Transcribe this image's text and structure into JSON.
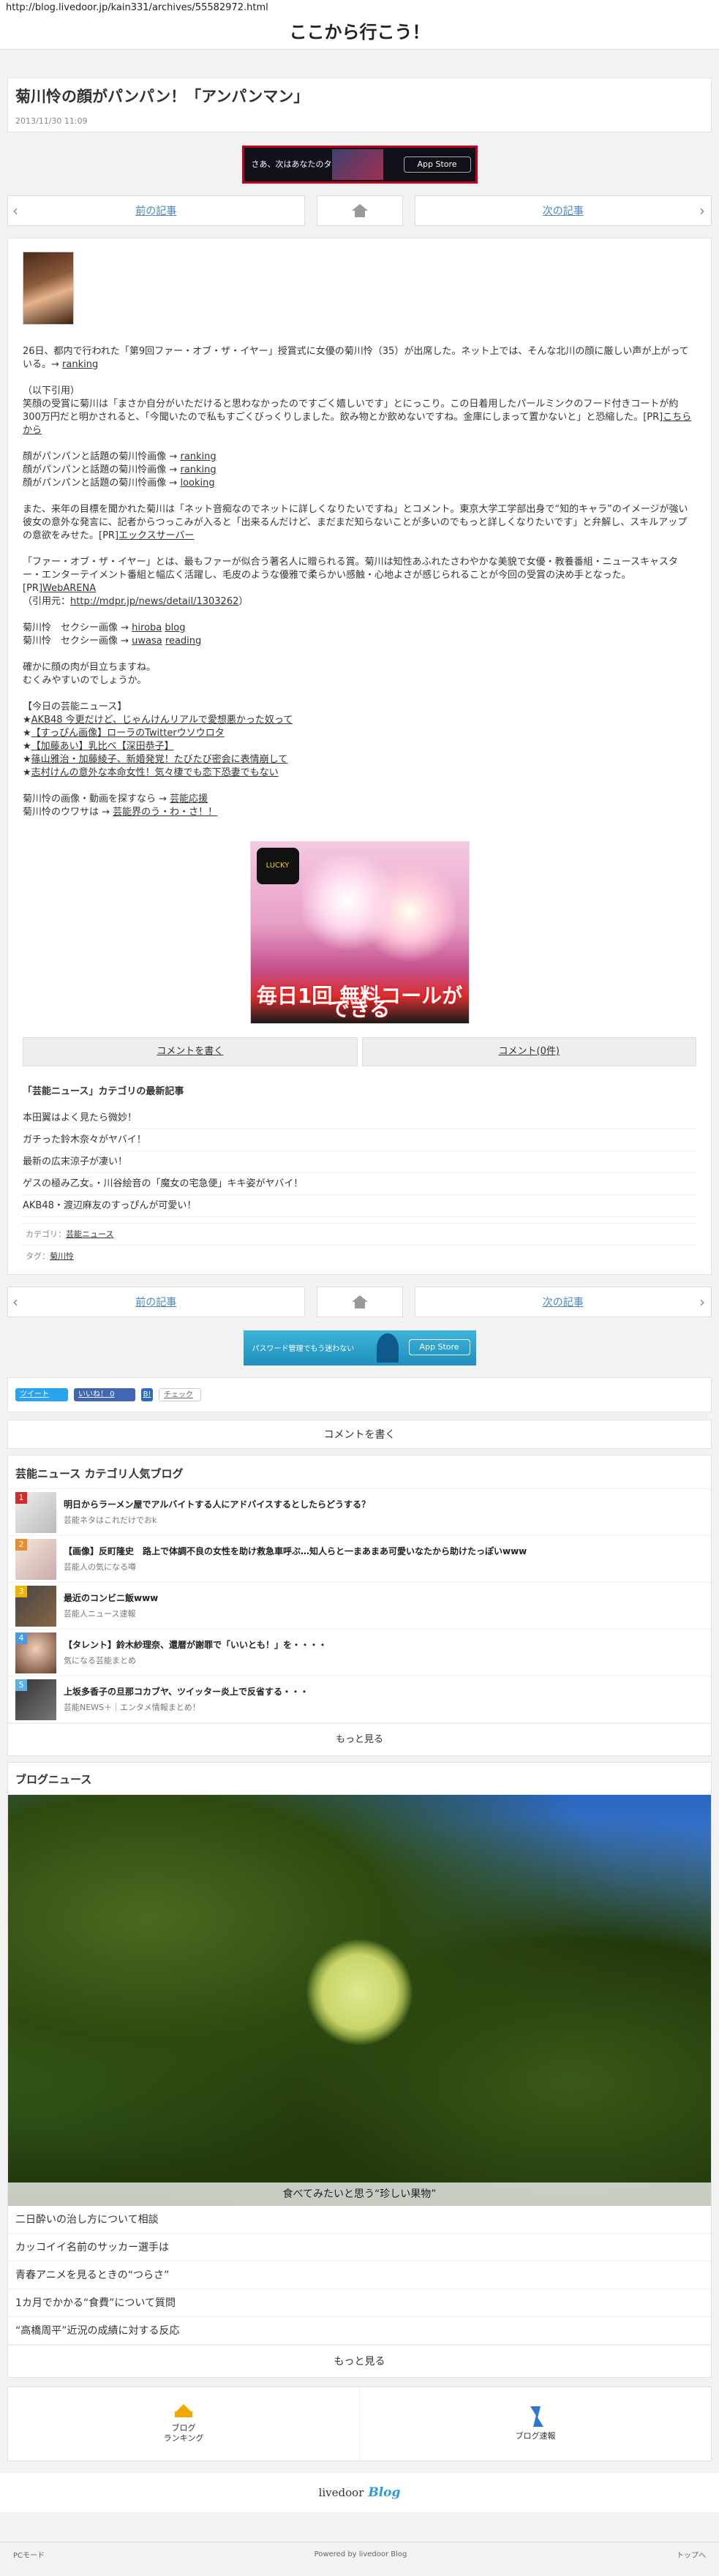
{
  "browser": {
    "url": "http://blog.livedoor.jp/kain331/archives/55582972.html"
  },
  "site": {
    "title": "ここから行こう！"
  },
  "article": {
    "title": "菊川怜の顔がパンパン！「アンパンマン」",
    "date": "2013/11/30 11:09"
  },
  "ads": {
    "banner1_text": "さあ、次はあなたのターン",
    "appstore": "App Store",
    "banner2_text": "パスワード管理でもう迷わない",
    "game_text": "毎日1回 無料コールができる",
    "game_logo": "LUCKY"
  },
  "pager": {
    "prev": "前の記事",
    "next": "次の記事",
    "prev_arrow": "‹",
    "next_arrow": "›"
  },
  "body": {
    "p1": "26日、都内で行われた「第9回ファー・オブ・ザ・イヤー」授賞式に女優の菊川怜（35）が出席した。ネット上では、そんな北川の顔に厳しい声が上がっている。→",
    "p1_link": "ranking",
    "p2": "（以下引用）\n笑顔の受賞に菊川は「まさか自分がいただけると思わなかったのですごく嬉しいです」とにっこり。この日着用したパールミンクのフード付きコートが約300万円だと明かされると、「今聞いたので私もすごくびっくりしました。飲み物とか飲めないですね。金庫にしまって置かないと」と恐縮した。[PR]",
    "p2_link": "こちらから",
    "l1": "顔がパンパンと話題の菊川怜画像 →",
    "l1_link": "ranking",
    "l2": "顔がパンパンと話題の菊川怜画像 →",
    "l2_link": "ranking",
    "l3": "顔がパンパンと話題の菊川怜画像 →",
    "l3_link": "looking",
    "p3": "また、来年の目標を聞かれた菊川は「ネット音痴なのでネットに詳しくなりたいですね」とコメント。東京大学工学部出身で“知的キャラ”のイメージが強い彼女の意外な発言に、記者からつっこみが入ると「出来るんだけど、まだまだ知らないことが多いのでもっと詳しくなりたいです」と弁解し、スキルアップの意欲をみせた。[PR]",
    "p3_link": "エックスサーバー",
    "p4": "「ファー・オブ・ザ・イヤー」とは、最もファーが似合う著名人に贈られる賞。菊川は知性あふれたさわやかな美貌で女優・教養番組・ニュースキャスター・エンターテイメント番組と幅広く活躍し、毛皮のような優雅で柔らかい感触・心地よさが感じられることが今回の受賞の決め手となった。",
    "p4_pr": "[PR]",
    "p4_link": "WebARENA",
    "p4_src": "（引用元：",
    "p4_src_link": "http://mdpr.jp/news/detail/1303262",
    "p4_src_end": "）",
    "s1": "菊川怜　セクシー画像 →",
    "s1_link1": "hiroba",
    "s1_link2": "blog",
    "s2": "菊川怜　セクシー画像 →",
    "s2_link1": "uwasa",
    "s2_link2": "reading",
    "p5a": "確かに顔の肉が目立ちますね。",
    "p5b": "むくみやすいのでしょうか。",
    "news_h": "【今日の芸能ニュース】",
    "n1": "AKB48 今更だけど、じゃんけんリアルで愛想悪かった奴って",
    "n2": "【すっぴん画像】ローラのTwitterウソウロタ",
    "n3": "【加藤あい】乳比べ【深田恭子】",
    "n4": "篠山雅治・加藤綾子、新婚発覚！たびたび密会に表情崩して",
    "n5": "志村けんの意外な本命女性！気々棲でも恋下恐妻でもない",
    "f1": "菊川怜の画像・動画を探すなら →",
    "f1_link": "芸能応援",
    "f2": "菊川怜のウワサは →",
    "f2_link": "芸能界のう・わ・さ！！"
  },
  "comments": {
    "write": "コメントを書く",
    "count": "コメント(0件)"
  },
  "category": {
    "heading": "「芸能ニュース」カテゴリの最新記事",
    "items": [
      "本田翼はよく見たら微妙！",
      "ガチった鈴木奈々がヤバイ！",
      "最新の広末涼子が凄い！",
      "ゲスの極み乙女。・川谷絵音の「魔女の宅急便」キキ姿がヤバイ！",
      "AKB48・渡辺麻友のすっぴんが可愛い！"
    ]
  },
  "meta": {
    "cat_label": "カテゴリ：",
    "cat_value": "芸能ニュース",
    "tag_label": "タグ：",
    "tag_value": "菊川怜"
  },
  "social": {
    "tweet": "ツイート",
    "like": "いいね！ 0",
    "hatena": "B!",
    "check": "チェック"
  },
  "write_comment": "コメントを書く",
  "popular": {
    "heading": "芸能ニュース カテゴリ人気ブログ",
    "items": [
      {
        "rank": "1",
        "title": "明日からラーメン屋でアルバイトする人にアドバイスするとしたらどうする？",
        "source": "芸能ネタはこれだけでおk"
      },
      {
        "rank": "2",
        "title": "【画像】反町隆史　路上で体調不良の女性を助け救急車呼ぶ…知人らと一まあまあ可愛いなたから助けたっぽいwww",
        "source": "芸能人の気になる噂"
      },
      {
        "rank": "3",
        "title": "最近のコンビニ飯www",
        "source": "芸能人ニュース速報"
      },
      {
        "rank": "4",
        "title": "【タレント】鈴木紗理奈、還暦が謝罪で「いいとも！」を・・・・",
        "source": "気になる芸能まとめ"
      },
      {
        "rank": "5",
        "title": "上坂多香子の旦那コカブヤ、ツイッター炎上で反省する・・・",
        "source": "芸能NEWS＋｜エンタメ情報まとめ！"
      }
    ],
    "more": "もっと見る"
  },
  "blognews": {
    "heading": "ブログニュース",
    "hero_caption": "食べてみたいと思う“珍しい果物”",
    "items": [
      "二日酔いの治し方について相談",
      "カッコイイ名前のサッカー選手は",
      "青春アニメを見るときの“つらさ”",
      "1カ月でかかる“食費”について質問",
      "“高橋周平”近況の成績に対する反応"
    ],
    "more": "もっと見る"
  },
  "bottom_nav": {
    "ranking_1": "ブログ",
    "ranking_2": "ランキング",
    "news": "ブログ速報"
  },
  "footer": {
    "logo_1": "livedoor",
    "logo_2": "Blog",
    "pc": "PCモード",
    "powered": "Powered by livedoor Blog",
    "top": "トップへ"
  }
}
